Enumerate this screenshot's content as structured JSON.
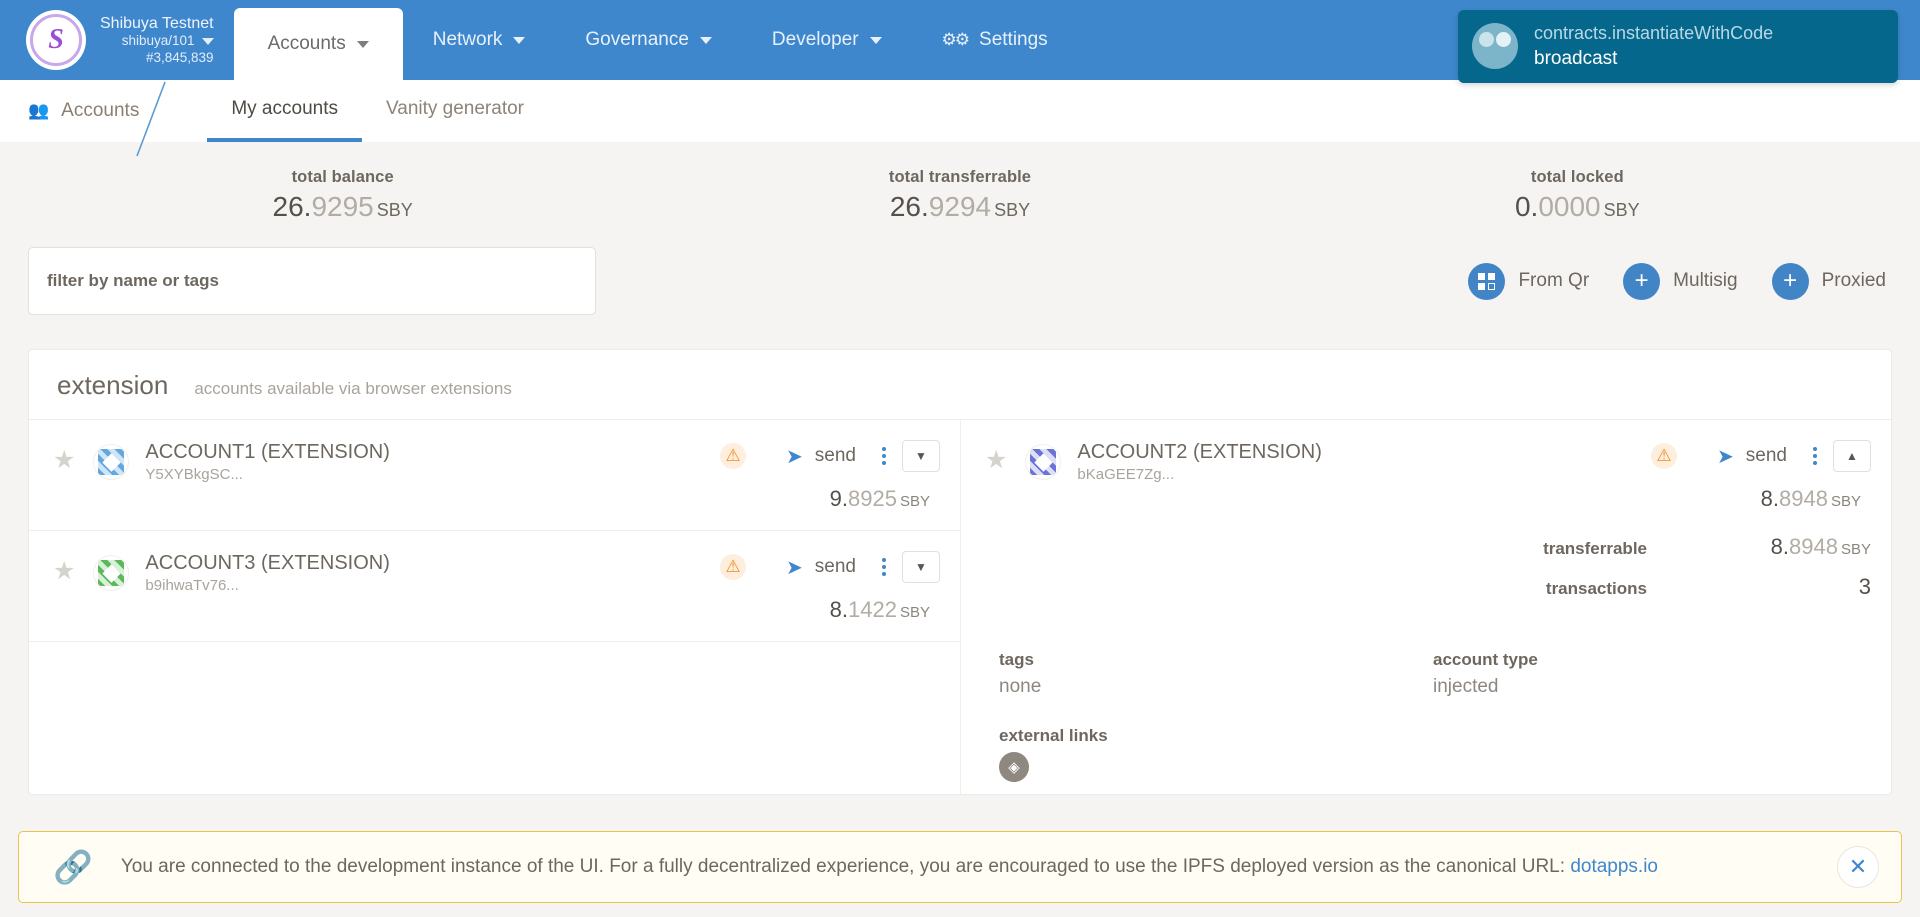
{
  "topbar": {
    "chain": {
      "name": "Shibuya Testnet",
      "spec": "shibuya/101",
      "block": "#3,845,839",
      "logo_letter": "S",
      "logo_accent": "#9b4fd4"
    },
    "nav": [
      {
        "label": "Accounts",
        "active": true,
        "has_caret": true,
        "icon": ""
      },
      {
        "label": "Network",
        "active": false,
        "has_caret": true,
        "icon": ""
      },
      {
        "label": "Governance",
        "active": false,
        "has_caret": true,
        "icon": ""
      },
      {
        "label": "Developer",
        "active": false,
        "has_caret": true,
        "icon": ""
      },
      {
        "label": "Settings",
        "active": false,
        "has_caret": false,
        "icon": "gear-icon"
      }
    ],
    "background": "#3f87cd"
  },
  "toast": {
    "title": "contracts.instantiateWithCode",
    "status": "broadcast",
    "background": "#05678c"
  },
  "subnav": {
    "section": "Accounts",
    "section_icon": "people-icon",
    "tabs": [
      {
        "label": "My accounts",
        "active": true
      },
      {
        "label": "Vanity generator",
        "active": false
      }
    ]
  },
  "summary": [
    {
      "label": "total balance",
      "int": "26.",
      "dec": "9295",
      "unit": "SBY"
    },
    {
      "label": "total transferrable",
      "int": "26.",
      "dec": "9294",
      "unit": "SBY"
    },
    {
      "label": "total locked",
      "int": "0.",
      "dec": "0000",
      "unit": "SBY"
    }
  ],
  "filter": {
    "placeholder": "filter by name or tags",
    "value": ""
  },
  "actions": [
    {
      "label": "From Qr",
      "icon": "qr-icon",
      "glyph": ""
    },
    {
      "label": "Multisig",
      "icon": "plus-icon",
      "glyph": "+"
    },
    {
      "label": "Proxied",
      "icon": "plus-icon",
      "glyph": "+"
    }
  ],
  "section": {
    "title": "extension",
    "subtitle": "accounts available via browser extensions"
  },
  "accounts": {
    "left": [
      {
        "name": "ACCOUNT1 (EXTENSION)",
        "address": "Y5XYBkgSC...",
        "ident_color": "blue",
        "send_label": "send",
        "warn": "⚠",
        "balance_int": "9.",
        "balance_dec": "8925",
        "unit": "SBY",
        "expanded": false
      },
      {
        "name": "ACCOUNT3 (EXTENSION)",
        "address": "b9ihwaTv76...",
        "ident_color": "green",
        "send_label": "send",
        "warn": "⚠",
        "balance_int": "8.",
        "balance_dec": "1422",
        "unit": "SBY",
        "expanded": false
      }
    ],
    "right": {
      "name": "ACCOUNT2 (EXTENSION)",
      "address": "bKaGEE7Zg...",
      "ident_color": "violet",
      "send_label": "send",
      "warn": "⚠",
      "balance_int": "8.",
      "balance_dec": "8948",
      "unit": "SBY",
      "expanded": true,
      "details": [
        {
          "label": "transferrable",
          "int": "8.",
          "dec": "8948",
          "unit": "SBY"
        },
        {
          "label": "transactions",
          "plain": "3"
        }
      ],
      "meta": [
        {
          "label": "tags",
          "value": "none"
        },
        {
          "label": "account type",
          "value": "injected"
        }
      ],
      "external_links_label": "external links",
      "external_link_icon": "polkascan-icon"
    }
  },
  "banner": {
    "icon": "link-icon",
    "text_before": "You are connected to the development instance of the UI. For a fully decentralized experience, you are encouraged to use the IPFS deployed version as the canonical URL: ",
    "link": "dotapps.io",
    "close": "✕",
    "accent": "#e8c44a"
  }
}
